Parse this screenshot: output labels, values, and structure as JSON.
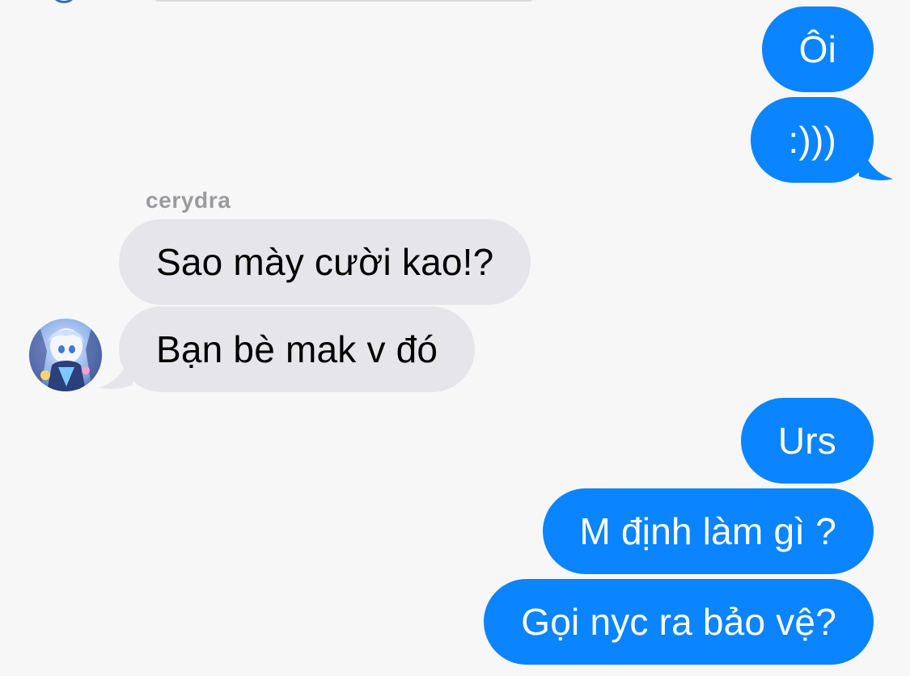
{
  "conversation": {
    "sender_name": "cerydra",
    "messages": [
      {
        "direction": "outgoing",
        "text": "Ôi"
      },
      {
        "direction": "outgoing",
        "text": ":)))"
      },
      {
        "direction": "incoming",
        "text": "Sao mày cười kao!?"
      },
      {
        "direction": "incoming",
        "text": "Bạn bè mak v đó"
      },
      {
        "direction": "outgoing",
        "text": "Urs"
      },
      {
        "direction": "outgoing",
        "text": "M định làm gì ?"
      },
      {
        "direction": "outgoing",
        "text": "Gọi nyc ra bảo vệ?"
      }
    ]
  },
  "colors": {
    "background": "#f7f7f7",
    "outgoing_bubble": "#0a84ff",
    "incoming_bubble": "#e6e5ea",
    "sender_name": "#9b9b9f"
  },
  "icons": {
    "avatar": "anime-character-avatar"
  }
}
